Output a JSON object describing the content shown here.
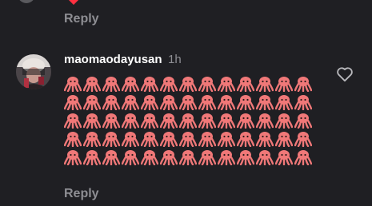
{
  "previous_comment": {
    "reaction_icon": "heart-icon",
    "reply_label": "Reply"
  },
  "comment": {
    "username": "maomaodayusan",
    "time": "1h",
    "avatar_icon": "user-avatar",
    "like_icon": "heart-outline-icon",
    "emoji": "🐙",
    "emoji_icon": "octopus-emoji",
    "emoji_count": 65,
    "emoji_per_row": 13,
    "reply_label": "Reply"
  },
  "colors": {
    "background": "#1f1f23",
    "text_primary": "#ffffff",
    "text_secondary": "#8e8e93",
    "octopus": "#f07878",
    "heart_red": "#ff3040"
  }
}
